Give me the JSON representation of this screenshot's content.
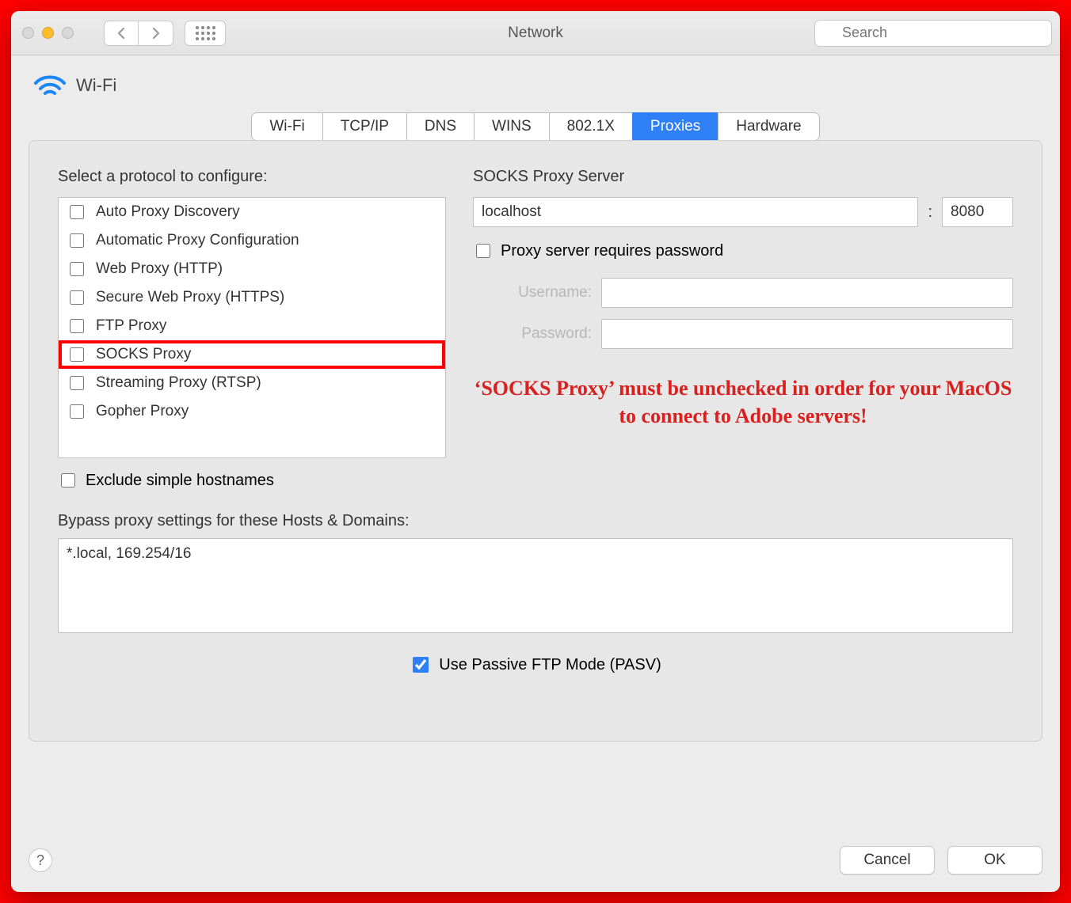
{
  "toolbar": {
    "title": "Network",
    "search_placeholder": "Search"
  },
  "panel": {
    "title": "Wi-Fi"
  },
  "tabs": [
    "Wi-Fi",
    "TCP/IP",
    "DNS",
    "WINS",
    "802.1X",
    "Proxies",
    "Hardware"
  ],
  "active_tab_index": 5,
  "proxies": {
    "select_label": "Select a protocol to configure:",
    "protocols": [
      {
        "label": "Auto Proxy Discovery",
        "checked": false,
        "highlight": false
      },
      {
        "label": "Automatic Proxy Configuration",
        "checked": false,
        "highlight": false
      },
      {
        "label": "Web Proxy (HTTP)",
        "checked": false,
        "highlight": false
      },
      {
        "label": "Secure Web Proxy (HTTPS)",
        "checked": false,
        "highlight": false
      },
      {
        "label": "FTP Proxy",
        "checked": false,
        "highlight": false
      },
      {
        "label": "SOCKS Proxy",
        "checked": false,
        "highlight": true
      },
      {
        "label": "Streaming Proxy (RTSP)",
        "checked": false,
        "highlight": false
      },
      {
        "label": "Gopher Proxy",
        "checked": false,
        "highlight": false
      }
    ],
    "exclude_simple_label": "Exclude simple hostnames",
    "exclude_simple_checked": false,
    "server_section_label": "SOCKS Proxy Server",
    "server_host": "localhost",
    "server_port": "8080",
    "requires_password_label": "Proxy server requires password",
    "requires_password_checked": false,
    "username_label": "Username:",
    "username_value": "",
    "password_label": "Password:",
    "password_value": "",
    "bypass_label": "Bypass proxy settings for these Hosts & Domains:",
    "bypass_value": "*.local, 169.254/16",
    "pasv_label": "Use Passive FTP Mode (PASV)",
    "pasv_checked": true
  },
  "annotation": "‘SOCKS Proxy’ must be unchecked in order for your MacOS to connect to Adobe servers!",
  "footer": {
    "cancel": "Cancel",
    "ok": "OK",
    "help": "?"
  }
}
